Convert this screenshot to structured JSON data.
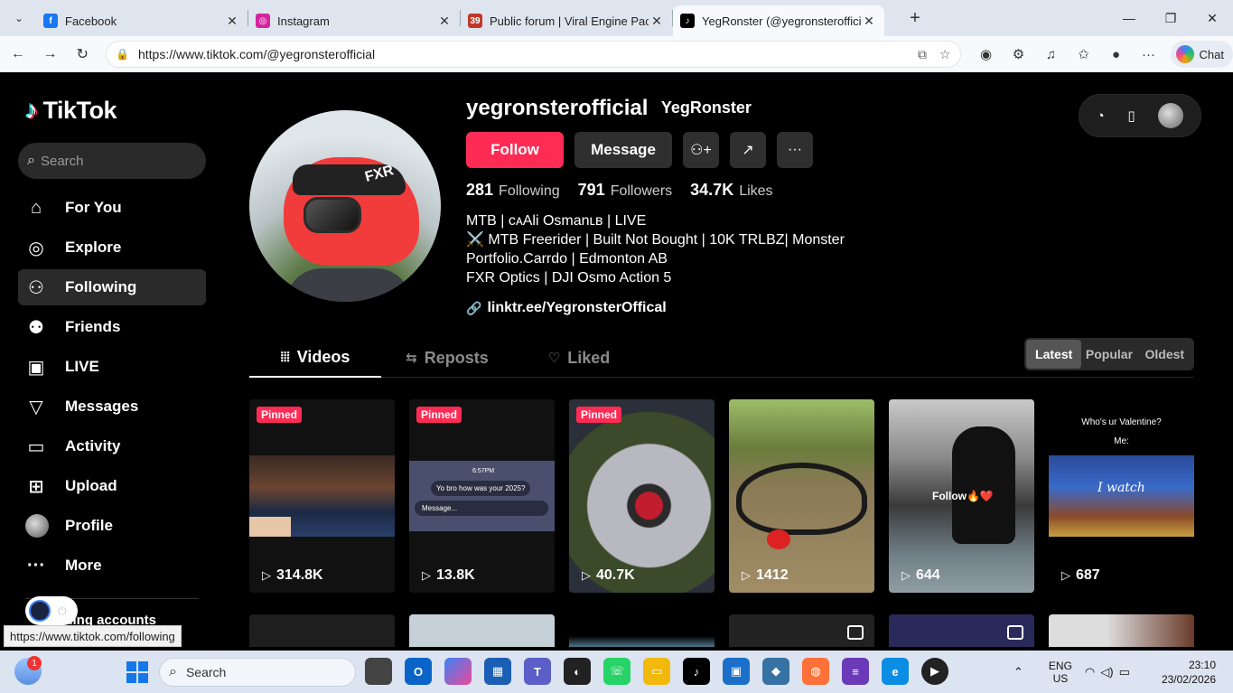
{
  "browser": {
    "tabs": [
      {
        "title": "Facebook",
        "icon": "facebook-icon",
        "color": "#1877f2",
        "glyph": "f",
        "active": false
      },
      {
        "title": "Instagram",
        "icon": "instagram-icon",
        "color": "#d6249f",
        "glyph": "◎",
        "active": false
      },
      {
        "title": "Public forum | Viral Engine Pack",
        "icon": "forum-icon",
        "color": "#c0392b",
        "glyph": "39",
        "active": false
      },
      {
        "title": "YegRonster (@yegronsterofficial) | TikTok",
        "icon": "tiktok-icon",
        "color": "#000000",
        "glyph": "♪",
        "active": true
      }
    ],
    "url": "https://www.tiktok.com/@yegronsterofficial",
    "chat_label": "Chat"
  },
  "sidebar": {
    "logo": "TikTok",
    "search_placeholder": "Search",
    "items": [
      {
        "label": "For You",
        "icon": "home-icon",
        "glyph": "⌂"
      },
      {
        "label": "Explore",
        "icon": "compass-icon",
        "glyph": "◎"
      },
      {
        "label": "Following",
        "icon": "following-icon",
        "glyph": "⚇"
      },
      {
        "label": "Friends",
        "icon": "friends-icon",
        "glyph": "⚉"
      },
      {
        "label": "LIVE",
        "icon": "live-icon",
        "glyph": "▣"
      },
      {
        "label": "Messages",
        "icon": "messages-icon",
        "glyph": "▽"
      },
      {
        "label": "Activity",
        "icon": "activity-icon",
        "glyph": "▭"
      },
      {
        "label": "Upload",
        "icon": "upload-icon",
        "glyph": "⊞"
      },
      {
        "label": "Profile",
        "icon": "profile-avatar-icon",
        "glyph": ""
      },
      {
        "label": "More",
        "icon": "more-icon",
        "glyph": "···"
      }
    ],
    "accounts_label": "...ing accounts",
    "status_url": "https://www.tiktok.com/following"
  },
  "profile": {
    "username": "yegronsterofficial",
    "nickname": "YegRonster",
    "follow_label": "Follow",
    "message_label": "Message",
    "stats": [
      {
        "num": "281",
        "label": "Following"
      },
      {
        "num": "791",
        "label": "Followers"
      },
      {
        "num": "34.7K",
        "label": "Likes"
      }
    ],
    "bio": [
      "MTB | ᴄᴀAli Osmanʟʙ | LIVE",
      "⚔️ MTB Freerider | Built Not Bought | 10K TRLBZ| Monster",
      "Portfolio.Carrdo | Edmonton AB",
      "FXR Optics | DJI Osmo Action 5"
    ],
    "link": "linktr.ee/YegronsterOffical"
  },
  "tabs": {
    "videos": "Videos",
    "reposts": "Reposts",
    "liked": "Liked"
  },
  "sort": {
    "latest": "Latest",
    "popular": "Popular",
    "oldest": "Oldest"
  },
  "videos": [
    {
      "views": "314.8K",
      "pinned": "Pinned"
    },
    {
      "views": "13.8K",
      "pinned": "Pinned"
    },
    {
      "views": "40.7K",
      "pinned": "Pinned"
    },
    {
      "views": "1412",
      "pinned": ""
    },
    {
      "views": "644",
      "pinned": ""
    },
    {
      "views": "687",
      "pinned": ""
    }
  ],
  "video_texts": {
    "chat_time": "6:57PM",
    "chat_bubble": "Yo bro how was your 2025?",
    "chat_input": "Message...",
    "follow_overlay": "Follow🔥❤️",
    "valentine_q": "Who's ur Valentine?",
    "valentine_me": "Me:",
    "valentine_i_watch": "I watch"
  },
  "taskbar": {
    "search": "Search",
    "weather_badge": "1",
    "lang_top": "ENG",
    "lang_bottom": "US",
    "time": "23:10",
    "date": "23/02/2026"
  }
}
